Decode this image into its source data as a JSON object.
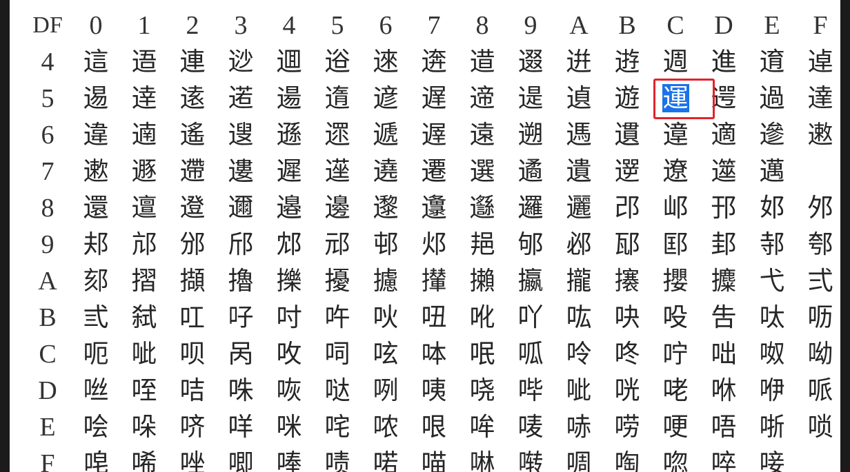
{
  "table": {
    "corner": "DF",
    "column_headers": [
      "0",
      "1",
      "2",
      "3",
      "4",
      "5",
      "6",
      "7",
      "8",
      "9",
      "A",
      "B",
      "C",
      "D",
      "E",
      "F"
    ],
    "rows": [
      {
        "label": "4",
        "cells": [
          "這",
          "逜",
          "連",
          "逤",
          "逥",
          "逧",
          "逨",
          "逩",
          "逪",
          "逫",
          "逬",
          "逰",
          "週",
          "進",
          "逳",
          "逴"
        ]
      },
      {
        "label": "5",
        "cells": [
          "逷",
          "逹",
          "逺",
          "逽",
          "逿",
          "遀",
          "遃",
          "遅",
          "遆",
          "遈",
          "遉",
          "遊",
          "運",
          "遌",
          "過",
          "達"
        ]
      },
      {
        "label": "6",
        "cells": [
          "違",
          "遖",
          "遙",
          "遚",
          "遜",
          "遝",
          "遞",
          "遟",
          "遠",
          "遡",
          "遤",
          "遦",
          "遧",
          "適",
          "遪",
          "遫"
        ]
      },
      {
        "label": "7",
        "cells": [
          "遬",
          "遯",
          "遰",
          "遱",
          "遲",
          "遳",
          "遶",
          "遷",
          "選",
          "遹",
          "遺",
          "遻",
          "遼",
          "遾",
          "邁",
          ""
        ]
      },
      {
        "label": "8",
        "cells": [
          "還",
          "邅",
          "邆",
          "邇",
          "邉",
          "邊",
          "邌",
          "邍",
          "邎",
          "邏",
          "邐",
          "邔",
          "邖",
          "邘",
          "邚",
          "邜"
        ]
      },
      {
        "label": "9",
        "cells": [
          "邞",
          "邟",
          "邠",
          "邤",
          "邥",
          "邧",
          "邨",
          "邩",
          "邫",
          "邭",
          "邲",
          "邷",
          "邼",
          "邽",
          "邿",
          "郀"
        ]
      },
      {
        "label": "A",
        "cells": [
          "郂",
          "摺",
          "擷",
          "擼",
          "擽",
          "擾",
          "攄",
          "攆",
          "攋",
          "攍",
          "攏",
          "攐",
          "攖",
          "攗",
          "弋",
          "弍"
        ]
      },
      {
        "label": "B",
        "cells": [
          "弎",
          "弑",
          "叿",
          "吇",
          "吋",
          "吘",
          "吙",
          "吜",
          "吪",
          "吖",
          "吰",
          "吷",
          "吺",
          "吿",
          "呔",
          "呖"
        ]
      },
      {
        "label": "C",
        "cells": [
          "呃",
          "呲",
          "呗",
          "呙",
          "呚",
          "呞",
          "呟",
          "呠",
          "呡",
          "呱",
          "呤",
          "咚",
          "咛",
          "咄",
          "呶",
          "呦"
        ]
      },
      {
        "label": "D",
        "cells": [
          "咝",
          "咥",
          "咭",
          "咮",
          "咴",
          "哒",
          "咧",
          "咦",
          "哓",
          "哔",
          "呲",
          "咣",
          "咾",
          "咻",
          "咿",
          "哌"
        ]
      },
      {
        "label": "E",
        "cells": [
          "哙",
          "哚",
          "哜",
          "咩",
          "咪",
          "咤",
          "哝",
          "哏",
          "哞",
          "唛",
          "哧",
          "唠",
          "哽",
          "唔",
          "哳",
          "唢"
        ]
      },
      {
        "label": "F",
        "cells": [
          "唣",
          "唏",
          "唑",
          "唧",
          "唪",
          "啧",
          "喏",
          "喵",
          "啉",
          "啭",
          "啁",
          "啕",
          "唿",
          "啐",
          "唼",
          ""
        ]
      }
    ],
    "selected": {
      "row": 1,
      "col": 12
    }
  }
}
